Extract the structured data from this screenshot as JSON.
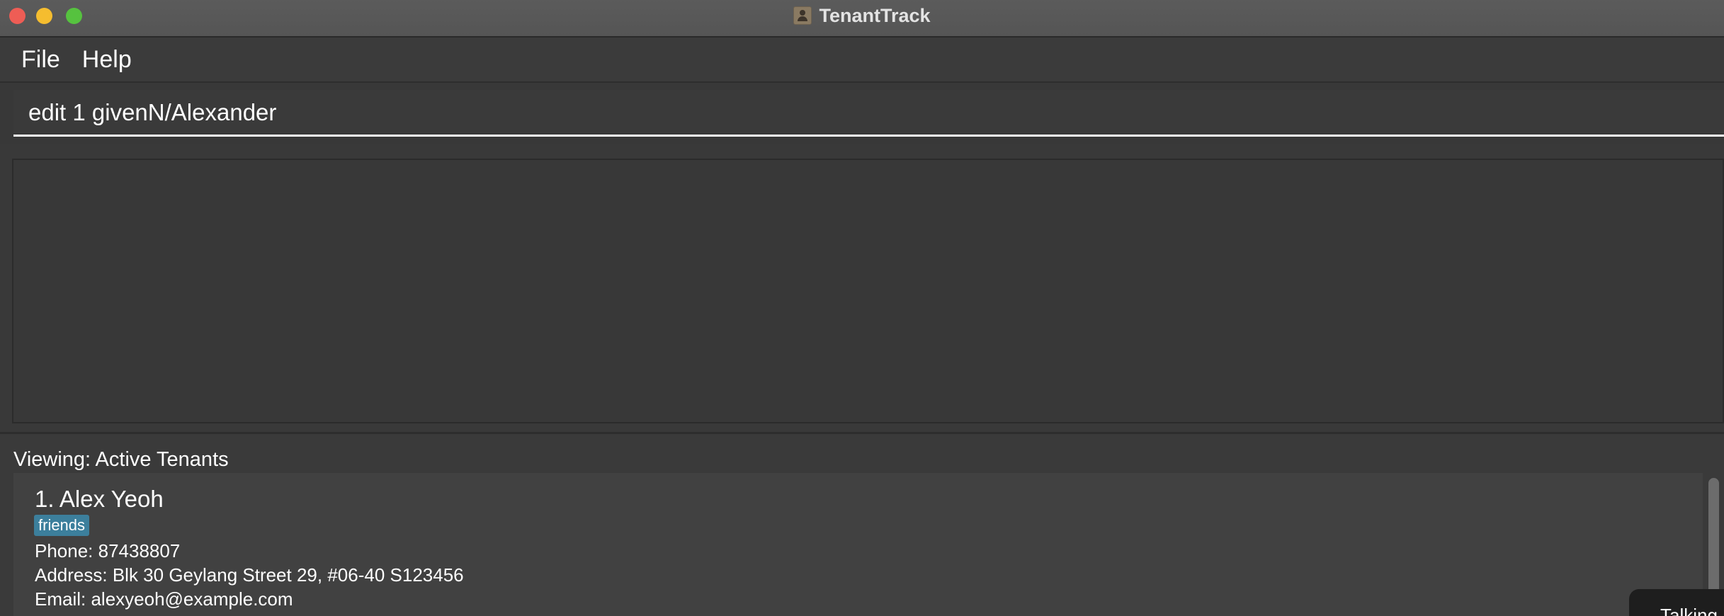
{
  "window": {
    "title": "TenantTrack",
    "app_icon": "contact-book-icon"
  },
  "menu": {
    "items": [
      {
        "label": "File"
      },
      {
        "label": "Help"
      }
    ]
  },
  "command": {
    "value": "edit 1 givenN/Alexander"
  },
  "result": {
    "text": ""
  },
  "list": {
    "viewing_label": "Viewing: Active Tenants",
    "tenants": [
      {
        "name": "1. Alex Yeoh",
        "tags": [
          "friends"
        ],
        "phone": "Phone: 87438807",
        "address": "Address: Blk 30 Geylang Street 29, #06-40 S123456",
        "email": "Email: alexyeoh@example.com"
      }
    ]
  },
  "toast": {
    "text": "Talking"
  },
  "colors": {
    "background": "#3a3a3a",
    "tag": "#3c7f9c",
    "close": "#ee5d55",
    "minimize": "#f5bd2f",
    "maximize": "#56c23f"
  }
}
